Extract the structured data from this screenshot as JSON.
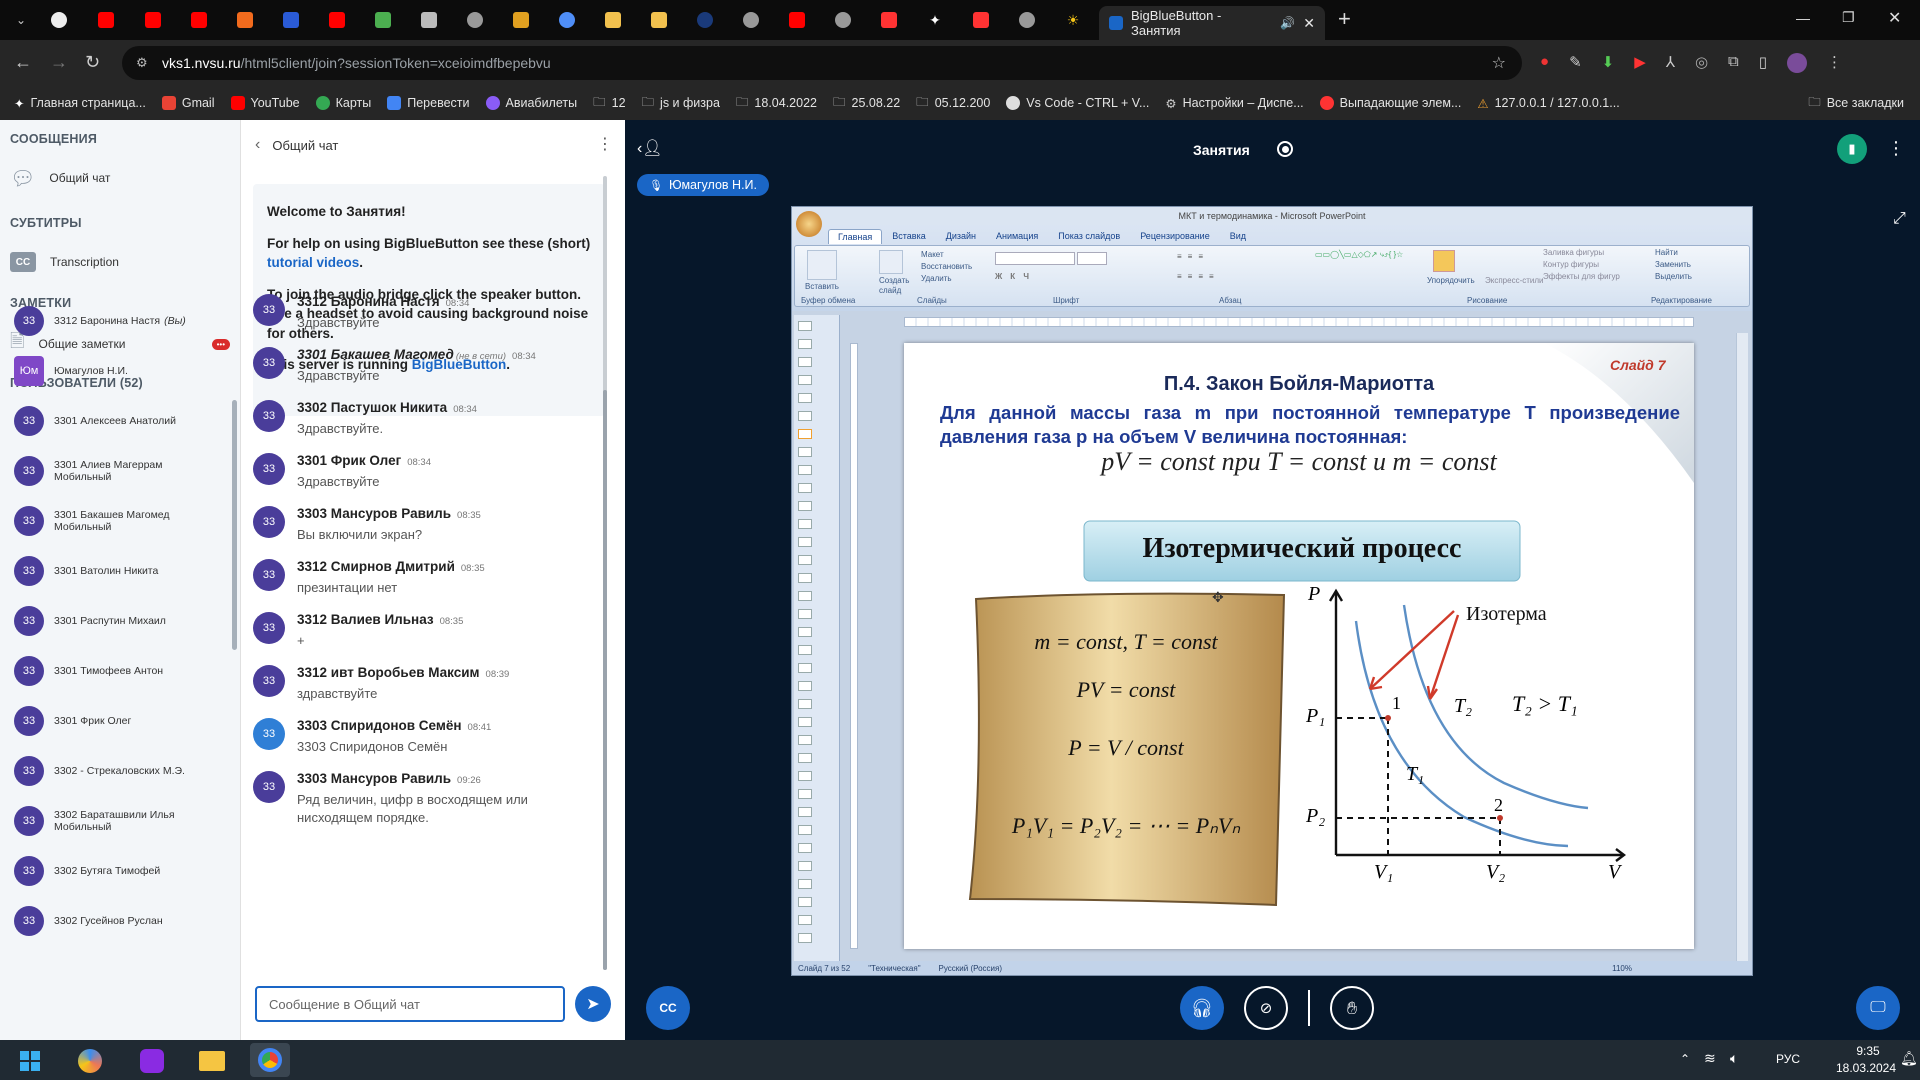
{
  "browser": {
    "active_tab_title": "BigBlueButton - Занятия",
    "url_host": "vks1.nvsu.ru",
    "url_path": "/html5client/join?sessionToken=xceioimdfbepebvu",
    "bookmarks": [
      "Главная страница...",
      "Gmail",
      "YouTube",
      "Карты",
      "Перевести",
      "Авиабилеты",
      "12",
      "js и физра",
      "18.04.2022",
      "25.08.22",
      "05.12.200",
      "Vs Code - CTRL + V...",
      "Настройки – Диспе...",
      "Выпадающие элем...",
      "127.0.0.1 / 127.0.0.1..."
    ],
    "all_bookmarks": "Все закладки"
  },
  "left": {
    "messages_header": "СООБЩЕНИЯ",
    "public_chat": "Общий чат",
    "subtitles_header": "СУБТИТРЫ",
    "transcription": "Transcription",
    "notes_header": "ЗАМЕТКИ",
    "shared_notes": "Общие заметки",
    "notes_badge": "•••",
    "users_header": "ПОЛЬЗОВАТЕЛИ (52)",
    "users": [
      {
        "av": "33",
        "name": "3312 Баронина Настя",
        "you": "(Вы)"
      },
      {
        "av": "Юм",
        "name": "Юмагулов Н.И.",
        "you": ""
      },
      {
        "av": "33",
        "name": "3301 Алексеев Анатолий",
        "you": ""
      },
      {
        "av": "33",
        "name": "3301 Алиев Магеррам",
        "sub": "Мобильный",
        "you": ""
      },
      {
        "av": "33",
        "name": "3301 Бакашев Магомед",
        "sub": "Мобильный",
        "you": ""
      },
      {
        "av": "33",
        "name": "3301 Ватолин Никита",
        "you": ""
      },
      {
        "av": "33",
        "name": "3301 Распутин Михаил",
        "you": ""
      },
      {
        "av": "33",
        "name": "3301 Тимофеев Антон",
        "you": ""
      },
      {
        "av": "33",
        "name": "3301 Фрик Олег",
        "you": ""
      },
      {
        "av": "33",
        "name": "3302 - Стрекаловских М.Э.",
        "you": ""
      },
      {
        "av": "33",
        "name": "3302 Бараташвили Илья",
        "sub": "Мобильный",
        "you": ""
      },
      {
        "av": "33",
        "name": "3302 Бутяга Тимофей",
        "you": ""
      },
      {
        "av": "33",
        "name": "3302 Гусейнов Руслан",
        "you": ""
      }
    ]
  },
  "chat": {
    "title": "Общий чат",
    "welcome_prefix": "Welcome to ",
    "welcome_room": "Занятия",
    "welcome_suffix": "!",
    "help_text": "For help on using BigBlueButton see these (short) ",
    "help_link": "tutorial videos",
    "audio_text": "To join the audio bridge click the speaker button. Use a headset to avoid causing background noise for others.",
    "server_text": "This server is running ",
    "server_link": "BigBlueButton",
    "messages": [
      {
        "name": "3312 Баронина Настя",
        "time": "08:34",
        "text": "Здравствуйте"
      },
      {
        "name": "3301 Бакашев Магомед",
        "offline": "(не в сети)",
        "time": "08:34",
        "text": "Здравствуйте"
      },
      {
        "name": "3302 Пастушок Никита",
        "time": "08:34",
        "text": "Здравствуйте."
      },
      {
        "name": "3301 Фрик Олег",
        "time": "08:34",
        "text": "Здравствуйте"
      },
      {
        "name": "3303 Мансуров Равиль",
        "time": "08:35",
        "text": "Вы включили экран?"
      },
      {
        "name": "3312 Смирнов Дмитрий",
        "time": "08:35",
        "text": "презинтации нет"
      },
      {
        "name": "3312 Валиев Ильназ",
        "time": "08:35",
        "text": "+"
      },
      {
        "name": "3312 ивт Воробьев Максим",
        "time": "08:39",
        "text": "здравствуйте"
      },
      {
        "name": "3303 Спиридонов Семён",
        "time": "08:41",
        "text": "3303 Спиридонов Семён"
      },
      {
        "name": "3303 Мансуров Равиль",
        "time": "09:26",
        "text": "Ряд величин, цифр в восходящем или нисходящем порядке."
      }
    ],
    "avatar_label": "33",
    "input_placeholder": "Сообщение в Общий чат"
  },
  "main": {
    "room_title": "Занятия",
    "presenter": "Юмагулов Н.И."
  },
  "ppt": {
    "window_title": "МКТ и термодинамика - Microsoft PowerPoint",
    "tabs": [
      "Главная",
      "Вставка",
      "Дизайн",
      "Анимация",
      "Показ слайдов",
      "Рецензирование",
      "Вид"
    ],
    "groups": [
      "Буфер обмена",
      "Слайды",
      "Шрифт",
      "Абзац",
      "Рисование",
      "Редактирование"
    ],
    "btn_paste": "Вставить",
    "btn_create": "Создать слайд",
    "btn_layout": "Макет",
    "btn_restore": "Восстановить",
    "btn_delete": "Удалить",
    "btn_arrange": "Упорядочить",
    "btn_styles": "Экспресс-стили",
    "btn_fill": "Заливка фигуры",
    "btn_outline": "Контур фигуры",
    "btn_effects": "Эффекты для фигур",
    "btn_find": "Найти",
    "btn_replace": "Заменить",
    "btn_select": "Выделить",
    "status_slide": "Слайд 7 из 52",
    "status_theme": "\"Техническая\"",
    "status_lang": "Русский (Россия)",
    "zoom": "110%"
  },
  "slide": {
    "number": "Слайд 7",
    "title": "П.4. Закон Бойля-Мариотта",
    "statement": "Для данной массы газа m при постоянной температуре T произведение давления газа p на объем V величина постоянная:",
    "formula": "pV = const  при T = const и m = const",
    "banner": "Изотермический процесс",
    "scroll_lines": [
      "m = const, T = const",
      "PV = const",
      "P = V / const",
      "P₁V₁ = P₂V₂ = ⋯ = PₙVₙ"
    ],
    "graph": {
      "isotherm_label": "Изотерма",
      "t2": "T₂",
      "t1": "T₁",
      "relation": "T₂ > T₁",
      "p_axis": "P",
      "v_axis": "V",
      "p1": "P₁",
      "p2": "P₂",
      "v1": "V₁",
      "v2": "V₂",
      "pt1": "1",
      "pt2": "2"
    }
  },
  "system": {
    "time": "9:35",
    "date": "18.03.2024",
    "lang": "РУС"
  }
}
